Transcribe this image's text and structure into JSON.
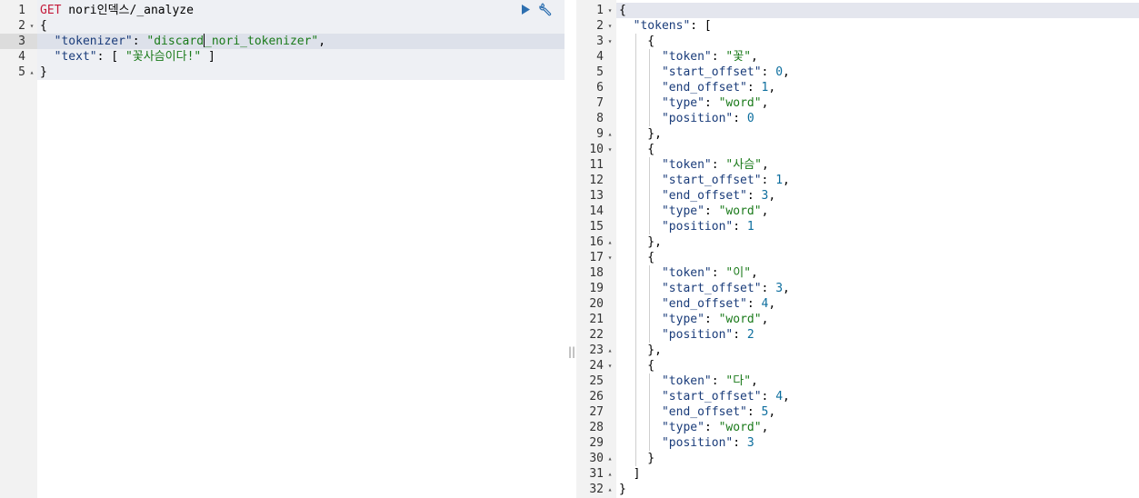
{
  "request": {
    "lines": [
      {
        "num": "1",
        "fold": "",
        "parts": [
          {
            "c": "m",
            "t": "GET"
          },
          {
            "c": "p",
            "t": " nori인덱스/_analyze"
          }
        ]
      },
      {
        "num": "2",
        "fold": "▾",
        "parts": [
          {
            "c": "p",
            "t": "{"
          }
        ]
      },
      {
        "num": "3",
        "fold": "",
        "parts": [
          {
            "c": "p",
            "t": "  "
          },
          {
            "c": "k",
            "t": "\"tokenizer\""
          },
          {
            "c": "p",
            "t": ": "
          },
          {
            "c": "s",
            "t": "\"discard"
          },
          {
            "c": "cursor",
            "t": ""
          },
          {
            "c": "s",
            "t": "_nori_tokenizer\""
          },
          {
            "c": "p",
            "t": ","
          }
        ]
      },
      {
        "num": "4",
        "fold": "",
        "parts": [
          {
            "c": "p",
            "t": "  "
          },
          {
            "c": "k",
            "t": "\"text\""
          },
          {
            "c": "p",
            "t": ": [ "
          },
          {
            "c": "s",
            "t": "\"꽃사슴이다!\""
          },
          {
            "c": "p",
            "t": " ]"
          }
        ]
      },
      {
        "num": "5",
        "fold": "▴",
        "parts": [
          {
            "c": "p",
            "t": "}"
          }
        ]
      }
    ]
  },
  "response": {
    "lines": [
      {
        "num": "1",
        "fold": "▾",
        "parts": [
          {
            "c": "p",
            "t": "{"
          }
        ]
      },
      {
        "num": "2",
        "fold": "▾",
        "parts": [
          {
            "c": "p",
            "t": "  "
          },
          {
            "c": "k",
            "t": "\"tokens\""
          },
          {
            "c": "p",
            "t": ": ["
          }
        ]
      },
      {
        "num": "3",
        "fold": "▾",
        "parts": [
          {
            "c": "p",
            "t": "    {"
          }
        ]
      },
      {
        "num": "4",
        "fold": "",
        "parts": [
          {
            "c": "p",
            "t": "      "
          },
          {
            "c": "k",
            "t": "\"token\""
          },
          {
            "c": "p",
            "t": ": "
          },
          {
            "c": "s",
            "t": "\"꽃\""
          },
          {
            "c": "p",
            "t": ","
          }
        ]
      },
      {
        "num": "5",
        "fold": "",
        "parts": [
          {
            "c": "p",
            "t": "      "
          },
          {
            "c": "k",
            "t": "\"start_offset\""
          },
          {
            "c": "p",
            "t": ": "
          },
          {
            "c": "n",
            "t": "0"
          },
          {
            "c": "p",
            "t": ","
          }
        ]
      },
      {
        "num": "6",
        "fold": "",
        "parts": [
          {
            "c": "p",
            "t": "      "
          },
          {
            "c": "k",
            "t": "\"end_offset\""
          },
          {
            "c": "p",
            "t": ": "
          },
          {
            "c": "n",
            "t": "1"
          },
          {
            "c": "p",
            "t": ","
          }
        ]
      },
      {
        "num": "7",
        "fold": "",
        "parts": [
          {
            "c": "p",
            "t": "      "
          },
          {
            "c": "k",
            "t": "\"type\""
          },
          {
            "c": "p",
            "t": ": "
          },
          {
            "c": "s",
            "t": "\"word\""
          },
          {
            "c": "p",
            "t": ","
          }
        ]
      },
      {
        "num": "8",
        "fold": "",
        "parts": [
          {
            "c": "p",
            "t": "      "
          },
          {
            "c": "k",
            "t": "\"position\""
          },
          {
            "c": "p",
            "t": ": "
          },
          {
            "c": "n",
            "t": "0"
          }
        ]
      },
      {
        "num": "9",
        "fold": "▴",
        "parts": [
          {
            "c": "p",
            "t": "    },"
          }
        ]
      },
      {
        "num": "10",
        "fold": "▾",
        "parts": [
          {
            "c": "p",
            "t": "    {"
          }
        ]
      },
      {
        "num": "11",
        "fold": "",
        "parts": [
          {
            "c": "p",
            "t": "      "
          },
          {
            "c": "k",
            "t": "\"token\""
          },
          {
            "c": "p",
            "t": ": "
          },
          {
            "c": "s",
            "t": "\"사슴\""
          },
          {
            "c": "p",
            "t": ","
          }
        ]
      },
      {
        "num": "12",
        "fold": "",
        "parts": [
          {
            "c": "p",
            "t": "      "
          },
          {
            "c": "k",
            "t": "\"start_offset\""
          },
          {
            "c": "p",
            "t": ": "
          },
          {
            "c": "n",
            "t": "1"
          },
          {
            "c": "p",
            "t": ","
          }
        ]
      },
      {
        "num": "13",
        "fold": "",
        "parts": [
          {
            "c": "p",
            "t": "      "
          },
          {
            "c": "k",
            "t": "\"end_offset\""
          },
          {
            "c": "p",
            "t": ": "
          },
          {
            "c": "n",
            "t": "3"
          },
          {
            "c": "p",
            "t": ","
          }
        ]
      },
      {
        "num": "14",
        "fold": "",
        "parts": [
          {
            "c": "p",
            "t": "      "
          },
          {
            "c": "k",
            "t": "\"type\""
          },
          {
            "c": "p",
            "t": ": "
          },
          {
            "c": "s",
            "t": "\"word\""
          },
          {
            "c": "p",
            "t": ","
          }
        ]
      },
      {
        "num": "15",
        "fold": "",
        "parts": [
          {
            "c": "p",
            "t": "      "
          },
          {
            "c": "k",
            "t": "\"position\""
          },
          {
            "c": "p",
            "t": ": "
          },
          {
            "c": "n",
            "t": "1"
          }
        ]
      },
      {
        "num": "16",
        "fold": "▴",
        "parts": [
          {
            "c": "p",
            "t": "    },"
          }
        ]
      },
      {
        "num": "17",
        "fold": "▾",
        "parts": [
          {
            "c": "p",
            "t": "    {"
          }
        ]
      },
      {
        "num": "18",
        "fold": "",
        "parts": [
          {
            "c": "p",
            "t": "      "
          },
          {
            "c": "k",
            "t": "\"token\""
          },
          {
            "c": "p",
            "t": ": "
          },
          {
            "c": "s",
            "t": "\"이\""
          },
          {
            "c": "p",
            "t": ","
          }
        ]
      },
      {
        "num": "19",
        "fold": "",
        "parts": [
          {
            "c": "p",
            "t": "      "
          },
          {
            "c": "k",
            "t": "\"start_offset\""
          },
          {
            "c": "p",
            "t": ": "
          },
          {
            "c": "n",
            "t": "3"
          },
          {
            "c": "p",
            "t": ","
          }
        ]
      },
      {
        "num": "20",
        "fold": "",
        "parts": [
          {
            "c": "p",
            "t": "      "
          },
          {
            "c": "k",
            "t": "\"end_offset\""
          },
          {
            "c": "p",
            "t": ": "
          },
          {
            "c": "n",
            "t": "4"
          },
          {
            "c": "p",
            "t": ","
          }
        ]
      },
      {
        "num": "21",
        "fold": "",
        "parts": [
          {
            "c": "p",
            "t": "      "
          },
          {
            "c": "k",
            "t": "\"type\""
          },
          {
            "c": "p",
            "t": ": "
          },
          {
            "c": "s",
            "t": "\"word\""
          },
          {
            "c": "p",
            "t": ","
          }
        ]
      },
      {
        "num": "22",
        "fold": "",
        "parts": [
          {
            "c": "p",
            "t": "      "
          },
          {
            "c": "k",
            "t": "\"position\""
          },
          {
            "c": "p",
            "t": ": "
          },
          {
            "c": "n",
            "t": "2"
          }
        ]
      },
      {
        "num": "23",
        "fold": "▴",
        "parts": [
          {
            "c": "p",
            "t": "    },"
          }
        ]
      },
      {
        "num": "24",
        "fold": "▾",
        "parts": [
          {
            "c": "p",
            "t": "    {"
          }
        ]
      },
      {
        "num": "25",
        "fold": "",
        "parts": [
          {
            "c": "p",
            "t": "      "
          },
          {
            "c": "k",
            "t": "\"token\""
          },
          {
            "c": "p",
            "t": ": "
          },
          {
            "c": "s",
            "t": "\"다\""
          },
          {
            "c": "p",
            "t": ","
          }
        ]
      },
      {
        "num": "26",
        "fold": "",
        "parts": [
          {
            "c": "p",
            "t": "      "
          },
          {
            "c": "k",
            "t": "\"start_offset\""
          },
          {
            "c": "p",
            "t": ": "
          },
          {
            "c": "n",
            "t": "4"
          },
          {
            "c": "p",
            "t": ","
          }
        ]
      },
      {
        "num": "27",
        "fold": "",
        "parts": [
          {
            "c": "p",
            "t": "      "
          },
          {
            "c": "k",
            "t": "\"end_offset\""
          },
          {
            "c": "p",
            "t": ": "
          },
          {
            "c": "n",
            "t": "5"
          },
          {
            "c": "p",
            "t": ","
          }
        ]
      },
      {
        "num": "28",
        "fold": "",
        "parts": [
          {
            "c": "p",
            "t": "      "
          },
          {
            "c": "k",
            "t": "\"type\""
          },
          {
            "c": "p",
            "t": ": "
          },
          {
            "c": "s",
            "t": "\"word\""
          },
          {
            "c": "p",
            "t": ","
          }
        ]
      },
      {
        "num": "29",
        "fold": "",
        "parts": [
          {
            "c": "p",
            "t": "      "
          },
          {
            "c": "k",
            "t": "\"position\""
          },
          {
            "c": "p",
            "t": ": "
          },
          {
            "c": "n",
            "t": "3"
          }
        ]
      },
      {
        "num": "30",
        "fold": "▴",
        "parts": [
          {
            "c": "p",
            "t": "    }"
          }
        ]
      },
      {
        "num": "31",
        "fold": "▴",
        "parts": [
          {
            "c": "p",
            "t": "  ]"
          }
        ]
      },
      {
        "num": "32",
        "fold": "▴",
        "parts": [
          {
            "c": "p",
            "t": "}"
          }
        ]
      }
    ]
  },
  "toolbar": {
    "run_icon": "play-icon",
    "settings_icon": "wrench-icon"
  },
  "resizer": {
    "handle": "||"
  },
  "colors": {
    "method": "#c41a3a",
    "key": "#1a3c7a",
    "string": "#1a7a1a",
    "number": "#0d6e9e",
    "gutter": "#f2f2f2",
    "request_bg": "#eef0f4",
    "toolbar_icon": "#2d6fb0"
  }
}
